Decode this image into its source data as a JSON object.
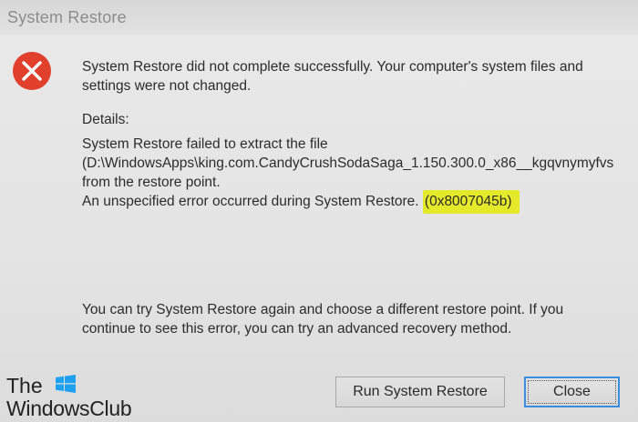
{
  "window": {
    "title": "System Restore"
  },
  "dialog": {
    "message_line1": "System Restore did not complete successfully. Your computer's system files and",
    "message_line2": "settings were not changed.",
    "details_label": "Details:",
    "details_line1": "System Restore failed to extract the file",
    "details_line2": "(D:\\WindowsApps\\king.com.CandyCrushSodaSaga_1.150.300.0_x86__kgqvnymyfvs",
    "details_line3": "from the restore point.",
    "details_line4": "An unspecified error occurred during System Restore.",
    "error_code": "(0x8007045b)",
    "hint_line1": "You can try System Restore again and choose a different restore point. If you",
    "hint_line2": "continue to see this error, you can try an advanced recovery method."
  },
  "buttons": {
    "run_label": "Run System Restore",
    "close_label": "Close"
  },
  "watermark": {
    "line1": "The",
    "line2": "WindowsClub"
  },
  "colors": {
    "error_red": "#e0402c",
    "highlight": "#e4e92a",
    "focus_blue": "#3b8de0"
  },
  "icons": {
    "error": "error-icon",
    "logo_flag": "windows-logo-icon"
  }
}
